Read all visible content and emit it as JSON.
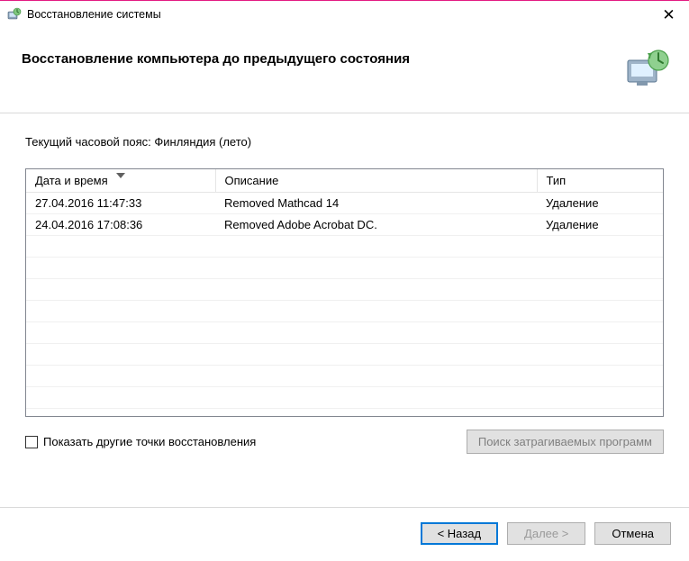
{
  "titlebar": {
    "title": "Восстановление системы"
  },
  "header": {
    "heading": "Восстановление компьютера до предыдущего состояния"
  },
  "body": {
    "timezone_line": "Текущий часовой пояс: Финляндия (лето)"
  },
  "table": {
    "headers": {
      "date": "Дата и время",
      "description": "Описание",
      "type": "Тип"
    },
    "rows": [
      {
        "date": "27.04.2016 11:47:33",
        "description": "Removed Mathcad 14",
        "type": "Удаление"
      },
      {
        "date": "24.04.2016 17:08:36",
        "description": "Removed Adobe Acrobat DC.",
        "type": "Удаление"
      }
    ]
  },
  "below": {
    "checkbox_label": "Показать другие точки восстановления",
    "scan_button": "Поиск затрагиваемых программ"
  },
  "footer": {
    "back": "< Назад",
    "next": "Далее >",
    "cancel": "Отмена"
  }
}
